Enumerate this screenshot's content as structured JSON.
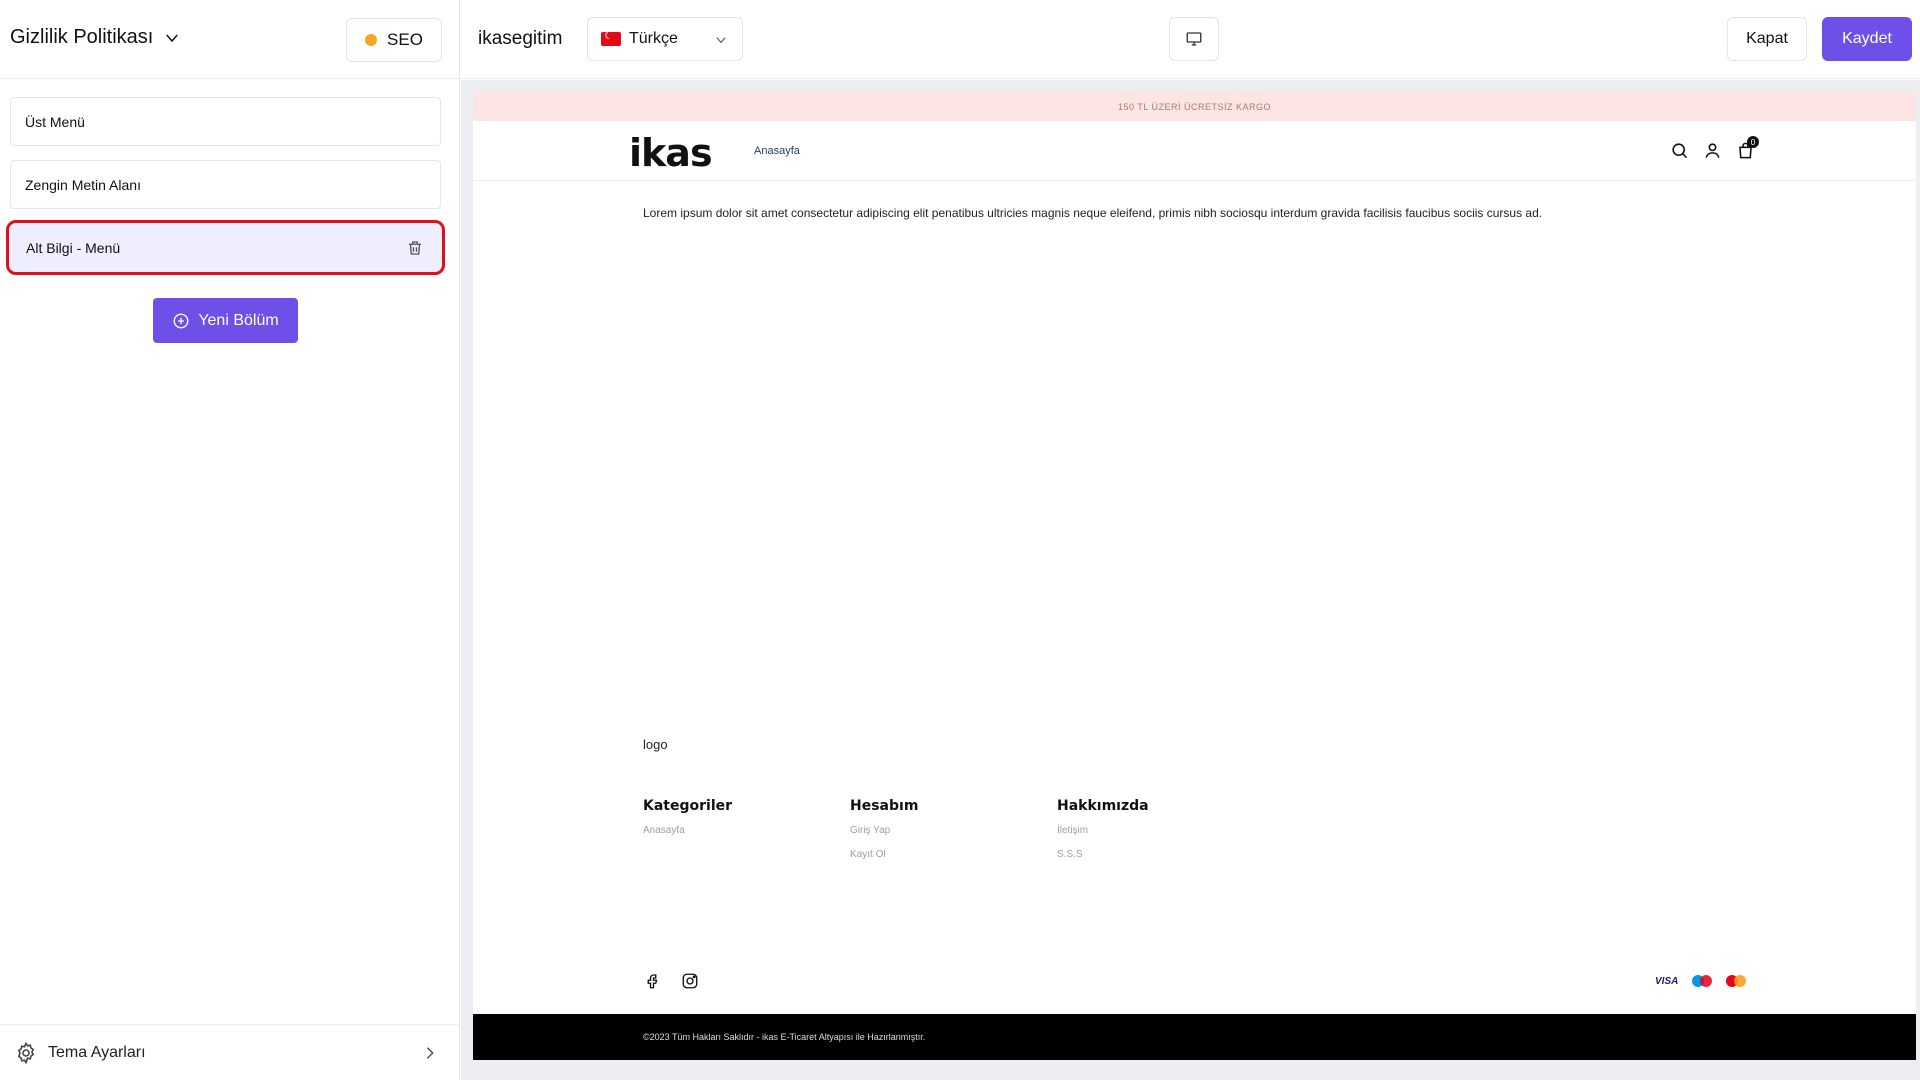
{
  "sidebar": {
    "page_title": "Gizlilik Politikası",
    "seo_label": "SEO",
    "sections": [
      {
        "label": "Üst Menü"
      },
      {
        "label": "Zengin Metin Alanı"
      },
      {
        "label": "Alt Bilgi - Menü"
      }
    ],
    "new_section_label": "Yeni Bölüm",
    "theme_settings_label": "Tema Ayarları"
  },
  "topbar": {
    "store_name": "ikasegitim",
    "language": "Türkçe",
    "close_label": "Kapat",
    "save_label": "Kaydet"
  },
  "preview": {
    "promo": "150 TL ÜZERİ ÜCRETSİZ KARGO",
    "logo": "ikas",
    "nav_home": "Anasayfa",
    "cart_count": "0",
    "body_text": "Lorem ipsum dolor sit amet consectetur adipiscing elit penatibus ultricies magnis neque eleifend, primis nibh sociosqu interdum gravida facilisis faucibus sociis cursus ad.",
    "footer_logo": "logo",
    "footer_columns": [
      {
        "title": "Kategoriler",
        "links": [
          "Anasayfa"
        ]
      },
      {
        "title": "Hesabım",
        "links": [
          "Giriş Yap",
          "Kayıt Ol"
        ]
      },
      {
        "title": "Hakkımızda",
        "links": [
          "İletişim",
          "S.S.S"
        ]
      }
    ],
    "payment_visa": "VISA",
    "copyright": "©2023 Tüm Hakları Saklıdır - ikas E-Ticaret Altyapısı ile Hazırlanmıştır."
  },
  "colors": {
    "accent": "#6e4fe8",
    "highlight_border": "#e0101a",
    "seo_dot": "#f5a623",
    "promo_bg": "#fde5e3"
  }
}
